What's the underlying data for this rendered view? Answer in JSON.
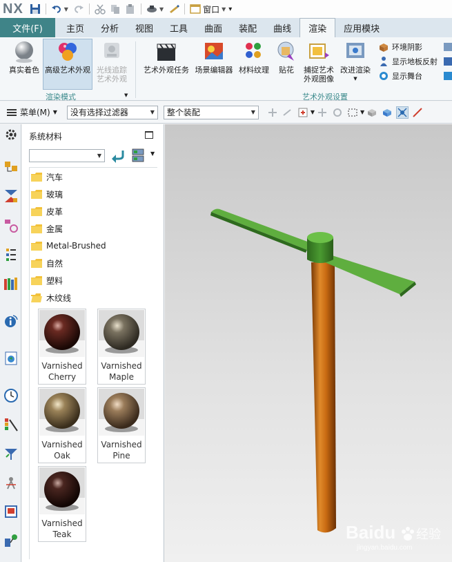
{
  "app": {
    "logo": "NX",
    "window_menu": "窗口"
  },
  "tabs": {
    "file": "文件(F)",
    "items": [
      "主页",
      "分析",
      "视图",
      "工具",
      "曲面",
      "装配",
      "曲线",
      "渲染",
      "应用模块"
    ],
    "active_index": 7
  },
  "ribbon": {
    "render_mode_group": {
      "label": "渲染模式",
      "buttons": [
        "真实着色",
        "高级艺术外观",
        "光线追踪",
        "艺术外观"
      ]
    },
    "appearance_group": {
      "label": "艺术外观设置",
      "buttons": [
        "艺术外观任务",
        "场景编辑器",
        "材料纹理",
        "贴花",
        "捕捉艺术",
        "外观图像",
        "改进渲染"
      ],
      "small_buttons": [
        "环境阴影",
        "显示地板反射",
        "显示舞台"
      ]
    }
  },
  "selection_bar": {
    "menu": "菜单(M)",
    "filter": "没有选择过滤器",
    "scope": "整个装配"
  },
  "panel": {
    "title": "系统材料",
    "combo_value": "",
    "folders": [
      "汽车",
      "玻璃",
      "皮革",
      "金属",
      "Metal-Brushed",
      "自然",
      "塑料",
      "木纹线"
    ],
    "materials": [
      {
        "line1": "Varnished",
        "line2": "Cherry",
        "color": "#4a1f1a"
      },
      {
        "line1": "Varnished",
        "line2": "Maple",
        "color": "#6e6654"
      },
      {
        "line1": "Varnished",
        "line2": "Oak",
        "color": "#8a7350"
      },
      {
        "line1": "Varnished",
        "line2": "Pine",
        "color": "#8a6f52"
      },
      {
        "line1": "Varnished",
        "line2": "Teak",
        "color": "#3a1c18"
      }
    ]
  },
  "watermark": {
    "brand": "Baidu",
    "cn": "经验",
    "url": "jingyan.baidu.com"
  },
  "colors": {
    "file_tab": "#3f8488",
    "accent": "#3b8a8c",
    "blade": "#5fae3f",
    "shaft": "#c86a12"
  }
}
